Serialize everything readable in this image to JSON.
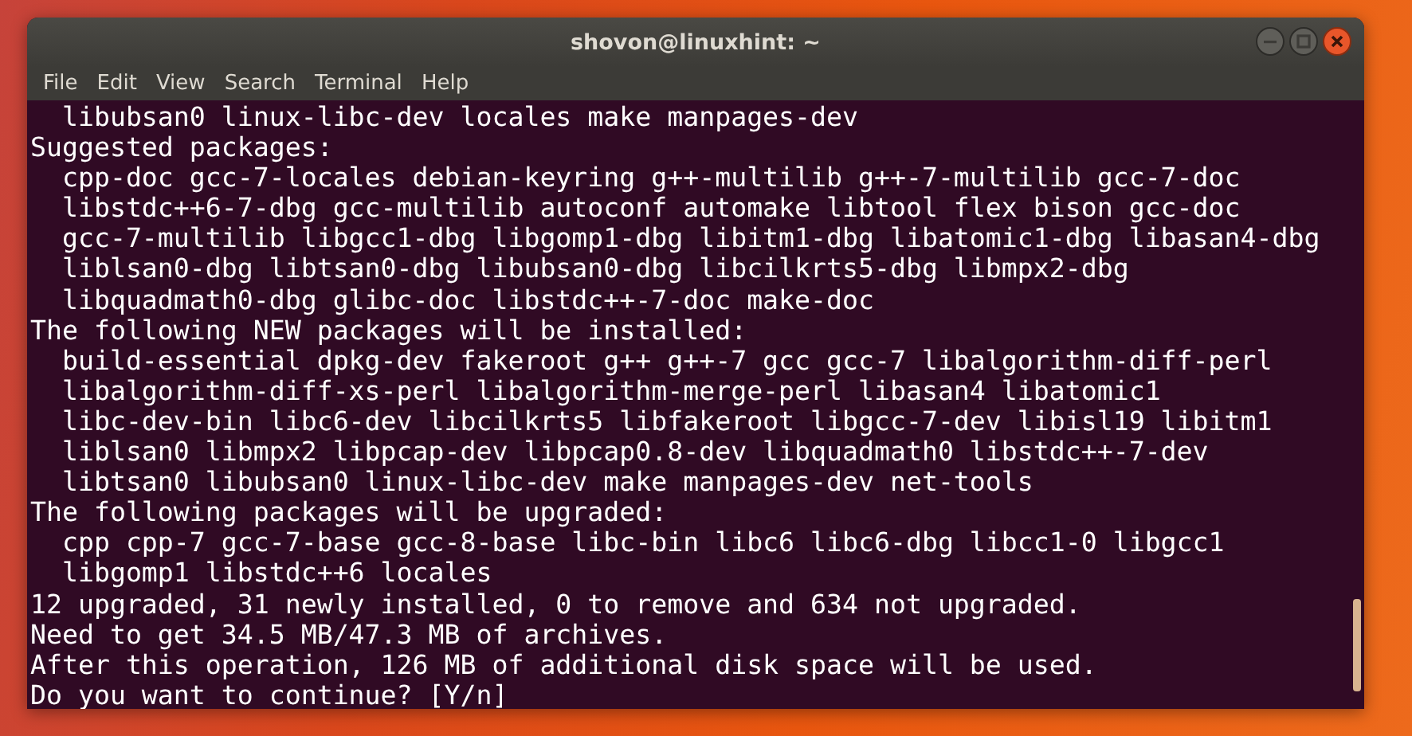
{
  "window": {
    "title": "shovon@linuxhint: ~"
  },
  "menu": [
    "File",
    "Edit",
    "View",
    "Search",
    "Terminal",
    "Help"
  ],
  "terminal": {
    "lines": [
      "  libubsan0 linux-libc-dev locales make manpages-dev",
      "Suggested packages:",
      "  cpp-doc gcc-7-locales debian-keyring g++-multilib g++-7-multilib gcc-7-doc",
      "  libstdc++6-7-dbg gcc-multilib autoconf automake libtool flex bison gcc-doc",
      "  gcc-7-multilib libgcc1-dbg libgomp1-dbg libitm1-dbg libatomic1-dbg libasan4-dbg",
      "  liblsan0-dbg libtsan0-dbg libubsan0-dbg libcilkrts5-dbg libmpx2-dbg",
      "  libquadmath0-dbg glibc-doc libstdc++-7-doc make-doc",
      "The following NEW packages will be installed:",
      "  build-essential dpkg-dev fakeroot g++ g++-7 gcc gcc-7 libalgorithm-diff-perl",
      "  libalgorithm-diff-xs-perl libalgorithm-merge-perl libasan4 libatomic1",
      "  libc-dev-bin libc6-dev libcilkrts5 libfakeroot libgcc-7-dev libisl19 libitm1",
      "  liblsan0 libmpx2 libpcap-dev libpcap0.8-dev libquadmath0 libstdc++-7-dev",
      "  libtsan0 libubsan0 linux-libc-dev make manpages-dev net-tools",
      "The following packages will be upgraded:",
      "  cpp cpp-7 gcc-7-base gcc-8-base libc-bin libc6 libc6-dbg libcc1-0 libgcc1",
      "  libgomp1 libstdc++6 locales",
      "12 upgraded, 31 newly installed, 0 to remove and 634 not upgraded.",
      "Need to get 34.5 MB/47.3 MB of archives.",
      "After this operation, 126 MB of additional disk space will be used.",
      "Do you want to continue? [Y/n]"
    ]
  }
}
